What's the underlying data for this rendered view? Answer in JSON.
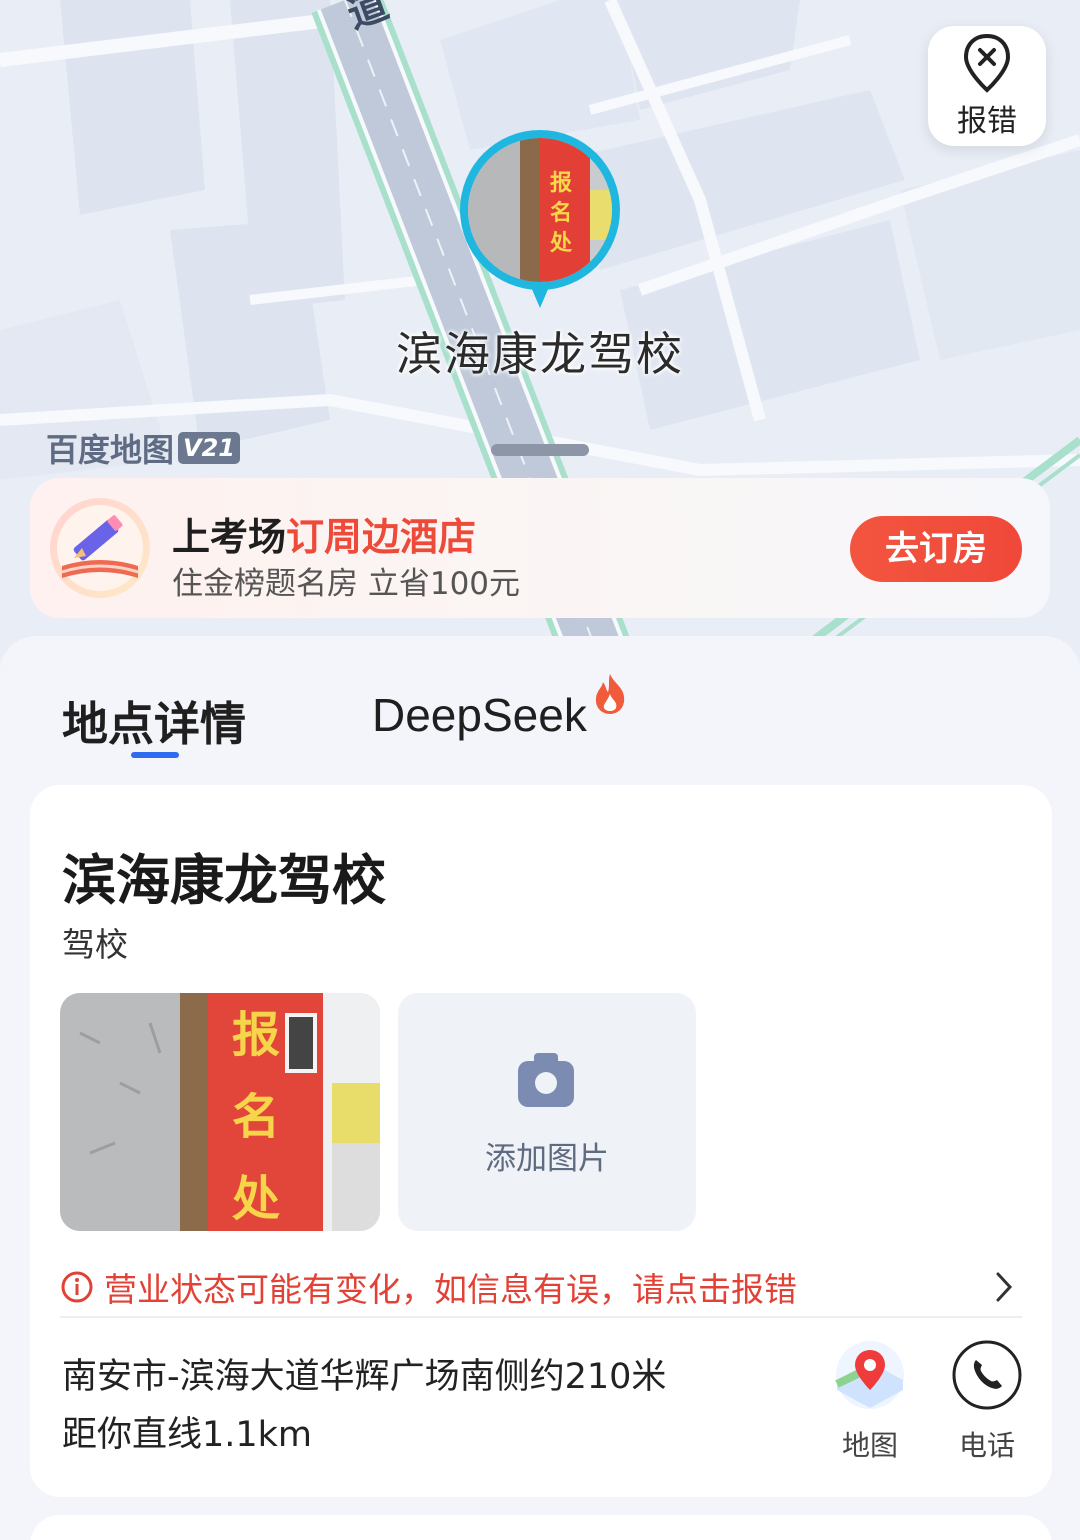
{
  "map": {
    "road_label": "道",
    "report_label": "报错",
    "poi_name": "滨海康龙驾校",
    "brand": "百度地图",
    "brand_version": "V21",
    "pin_photo_text": "报名处"
  },
  "promo": {
    "title_prefix": "上考场",
    "title_highlight": "订周边酒店",
    "subtitle": "住金榜题名房 立省100元",
    "button": "去订房"
  },
  "tabs": [
    {
      "label": "地点详情",
      "active": true
    },
    {
      "label": "DeepSeek",
      "active": false
    }
  ],
  "place": {
    "name": "滨海康龙驾校",
    "category": "驾校",
    "photo_text": "报名处",
    "add_photo": "添加图片",
    "warning": "营业状态可能有变化，如信息有误，请点击报错",
    "address": "南安市-滨海大道华辉广场南侧约210米",
    "distance": "距你直线1.1km",
    "actions": {
      "map": "地图",
      "phone": "电话"
    }
  },
  "colors": {
    "accent_red": "#ee4a39",
    "accent_blue": "#2f6bf0",
    "warning_red": "#e24236"
  }
}
